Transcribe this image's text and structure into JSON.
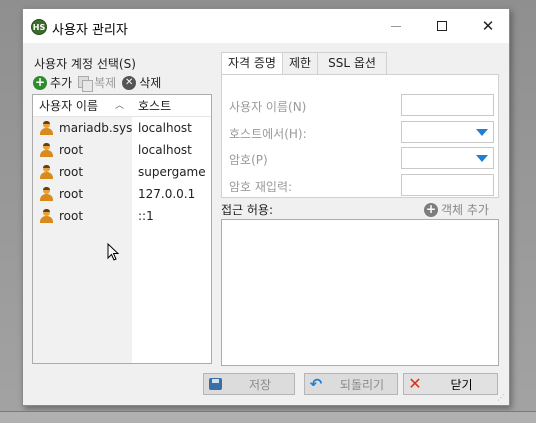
{
  "window": {
    "title": "사용자 관리자",
    "app_icon_text": "HS"
  },
  "accounts": {
    "label": "사용자 계정 선택(S)",
    "toolbar": {
      "add": "추가",
      "copy": "복제",
      "delete": "삭제"
    },
    "columns": {
      "username": "사용자 이름",
      "host": "호스트"
    },
    "rows": [
      {
        "username": "mariadb.sys",
        "host": "localhost"
      },
      {
        "username": "root",
        "host": "localhost"
      },
      {
        "username": "root",
        "host": "supergame"
      },
      {
        "username": "root",
        "host": "127.0.0.1"
      },
      {
        "username": "root",
        "host": "::1"
      }
    ]
  },
  "tabs": [
    "자격 증명",
    "제한",
    "SSL 옵션"
  ],
  "credentials": {
    "username_label": "사용자 이름(N)",
    "from_host_label": "호스트에서(H):",
    "password_label": "암호(P)",
    "password_repeat_label": "암호 재입력:"
  },
  "access": {
    "label": "접근 허용:",
    "add_object": "객체 추가"
  },
  "buttons": {
    "save": "저장",
    "revert": "되돌리기",
    "close": "닫기"
  },
  "colors": {
    "accent": "#1e7fd8",
    "close_x": "#d9301e",
    "add_green": "#2e8b2e"
  }
}
